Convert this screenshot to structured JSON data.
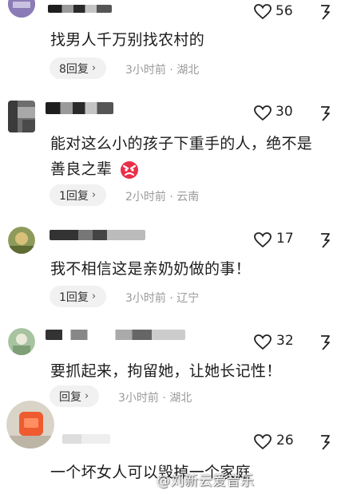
{
  "comments": [
    {
      "likes": "56",
      "text": "找男人千万别找农村的",
      "reply_label": "8回复",
      "time": "3小时前",
      "location": "湖北"
    },
    {
      "likes": "30",
      "text_line1": "能对这么小的孩子下重手的人，绝不是",
      "text_line2": "善良之辈",
      "reply_label": "1回复",
      "time": "2小时前",
      "location": "云南"
    },
    {
      "likes": "17",
      "text": "我不相信这是亲奶奶做的事！",
      "reply_label": "1回复",
      "time": "3小时前",
      "location": "辽宁"
    },
    {
      "likes": "32",
      "text": "要抓起来，拘留她，让她长记性！",
      "reply_label": "回复",
      "time": "3小时前",
      "location": "湖北"
    },
    {
      "likes": "26",
      "text": "一个坏女人可以毁掉一个家庭"
    }
  ],
  "separator": "·",
  "chevron": "›",
  "watermark": "@刘新云爱音乐"
}
